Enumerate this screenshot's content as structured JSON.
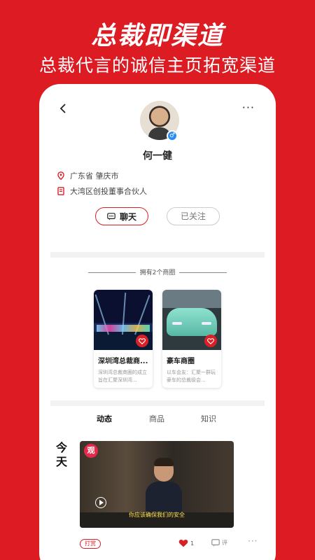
{
  "hero": {
    "title": "总裁即渠道",
    "subtitle": "总裁代言的诚信主页拓宽渠道"
  },
  "header": {
    "back_icon": "chevron-left-icon",
    "more_label": "···"
  },
  "profile": {
    "gender_symbol": "♂",
    "name": "何一健",
    "location": "广东省 肇庆市",
    "title": "大湾区创投董事合伙人",
    "chat_label": "聊天",
    "followed_label": "已关注"
  },
  "circles": {
    "header": "拥有2个商圈",
    "items": [
      {
        "name": "深圳湾总裁商...",
        "desc": "深圳湾总裁商圈的成立旨在汇聚深圳湾..."
      },
      {
        "name": "豪车商圈",
        "desc": "以车会友：汇聚一群玩豪车的总裁级会..."
      }
    ]
  },
  "feed": {
    "tabs": [
      "动态",
      "商品",
      "知识"
    ],
    "active_tab": 0,
    "date_label": "今天",
    "video_logo": "观",
    "video_subtitle": "你应该确保我们的安全",
    "reward_label": "打赏",
    "like_count": "1",
    "comment_label": "评",
    "more_label": "···"
  },
  "colors": {
    "brand_red": "#dc1b23",
    "accent": "#d92027",
    "gender_blue": "#2a8cf0"
  }
}
